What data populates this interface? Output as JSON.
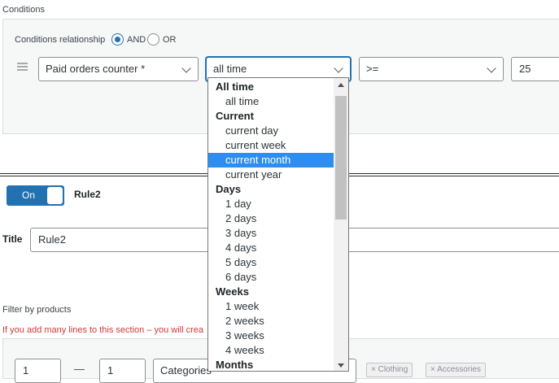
{
  "conditions": {
    "section_title": "Conditions",
    "relationship_label": "Conditions relationship",
    "option_and": "AND",
    "option_or": "OR",
    "field_select": "Paid orders counter *",
    "period_select": "all time",
    "operator_select": ">=",
    "value_input": "25"
  },
  "dropdown": {
    "rows": [
      {
        "label": "All time",
        "group": true
      },
      {
        "label": "all time",
        "group": false
      },
      {
        "label": "Current",
        "group": true
      },
      {
        "label": "current day",
        "group": false
      },
      {
        "label": "current week",
        "group": false
      },
      {
        "label": "current month",
        "group": false,
        "selected": true
      },
      {
        "label": "current year",
        "group": false
      },
      {
        "label": "Days",
        "group": true
      },
      {
        "label": "1 day",
        "group": false
      },
      {
        "label": "2 days",
        "group": false
      },
      {
        "label": "3 days",
        "group": false
      },
      {
        "label": "4 days",
        "group": false
      },
      {
        "label": "5 days",
        "group": false
      },
      {
        "label": "6 days",
        "group": false
      },
      {
        "label": "Weeks",
        "group": true
      },
      {
        "label": "1 week",
        "group": false
      },
      {
        "label": "2 weeks",
        "group": false
      },
      {
        "label": "3 weeks",
        "group": false
      },
      {
        "label": "4 weeks",
        "group": false
      },
      {
        "label": "Months",
        "group": true
      }
    ]
  },
  "rule": {
    "toggle_label": "On",
    "name": "Rule2",
    "title_label": "Title",
    "title_value": "Rule2"
  },
  "filter": {
    "label": "Filter by products",
    "warning": "If you add many lines to this section – you will crea",
    "qty_from": "1",
    "dash": "—",
    "qty_to": "1",
    "type_select": "Categories",
    "tags": [
      "× Clothing",
      "× Accessories"
    ]
  },
  "colors": {
    "accent": "#2271b1",
    "selected_option": "#2d8ef0",
    "warning": "#d63638"
  }
}
